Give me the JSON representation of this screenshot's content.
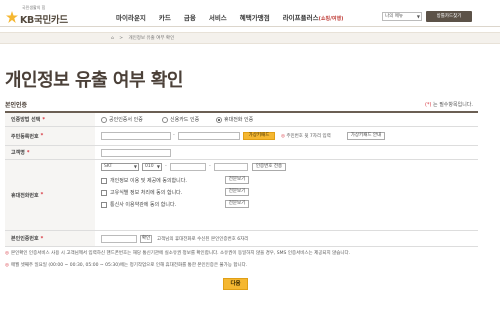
{
  "header": {
    "slogan": "국민생활의 힘",
    "logo_text": "KB국민카드",
    "nav": [
      {
        "label": "마이라운지",
        "sub": ""
      },
      {
        "label": "카드",
        "sub": ""
      },
      {
        "label": "금융",
        "sub": ""
      },
      {
        "label": "서비스",
        "sub": ""
      },
      {
        "label": "혜택가맹점",
        "sub": ""
      },
      {
        "label": "라이프플러스",
        "sub": "(쇼핑/여행)"
      }
    ],
    "my_menu": "나의 메뉴",
    "family_site": "방틀카드찾기"
  },
  "breadcrumb": [
    "개인정보 유출 여부 확인"
  ],
  "page_title": "개인정보 유출 여부 확인",
  "section_title": "본인인증",
  "required_note": {
    "mark": "(*)",
    "text": "는 필수항목입니다."
  },
  "form": {
    "auth_method": {
      "label": "인증방법 선택",
      "options": [
        "공인인증서 인증",
        "신용카드 인증",
        "휴대전화 인증"
      ],
      "selected": "휴대전화 인증"
    },
    "resident_no": {
      "label": "주민등록번호",
      "keypad_button": "가상키패드",
      "note_mark": "◎",
      "note": "주민번호 뒷 7자리 입력",
      "guide_button": "가상키패드 안내"
    },
    "customer_name": {
      "label": "고객명"
    },
    "mobile": {
      "label": "휴대전화번호",
      "carrier": "SKT",
      "prefix": "010",
      "send_button": "인증번호 전송",
      "agreements": [
        {
          "text": "개인정보 이용 및 제공에 동의합니다.",
          "button": "전문보기"
        },
        {
          "text": "고유식별 정보 처리에 동의 합니다.",
          "button": "전문보기"
        },
        {
          "text": "통신사 이용약관에 동의 합니다.",
          "button": "전문보기"
        }
      ]
    },
    "auth_code": {
      "label": "본인인증번호",
      "button": "확인",
      "note": "고객님의 휴대전화로 수신된 본인인증번호 6자리"
    }
  },
  "notices": [
    {
      "mark": "◎",
      "text": "본인확인 인증서비스 사용 시 고객님께서 입력하신 핸드폰번호는 해당 통신기관에 실소유권 정보를 확인합니다. 소유권이 동일하지 않을 경우, SMS 인증서비스는 제공되지 않습니다."
    },
    {
      "mark": "◎",
      "text": "매월 셋째주 일요일 (00:00 ~ 00:30, 05:00 ~ 05:30)에는 정기작업으로 인해 휴대전화를 통한 본인인증은 불가능 합니다."
    }
  ],
  "next_button": "다음",
  "colors": {
    "accent": "#f5b731",
    "brand": "#5c5248",
    "required": "#d6313b"
  }
}
